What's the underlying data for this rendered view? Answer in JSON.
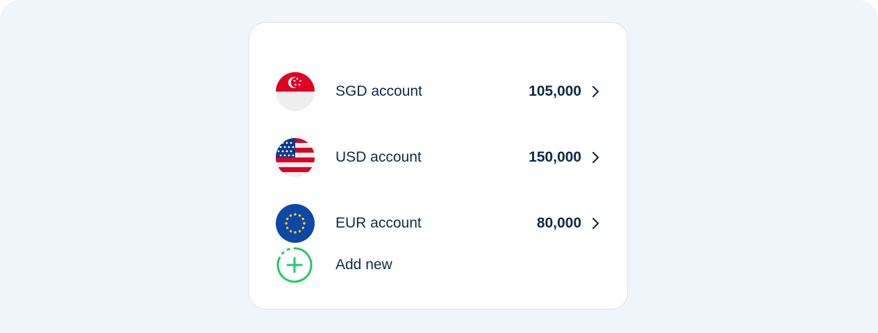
{
  "accounts": [
    {
      "label": "SGD account",
      "amount": "105,000",
      "flag_icon": "singapore-flag-icon"
    },
    {
      "label": "USD account",
      "amount": "150,000",
      "flag_icon": "usa-flag-icon"
    },
    {
      "label": "EUR account",
      "amount": "80,000",
      "flag_icon": "eu-flag-icon"
    }
  ],
  "add_new": {
    "label": "Add new",
    "icon": "plus-circle-icon"
  },
  "colors": {
    "background": "#f0f4fb",
    "card": "#ffffff",
    "text": "#0e2a47",
    "accent_green": "#22c766"
  }
}
